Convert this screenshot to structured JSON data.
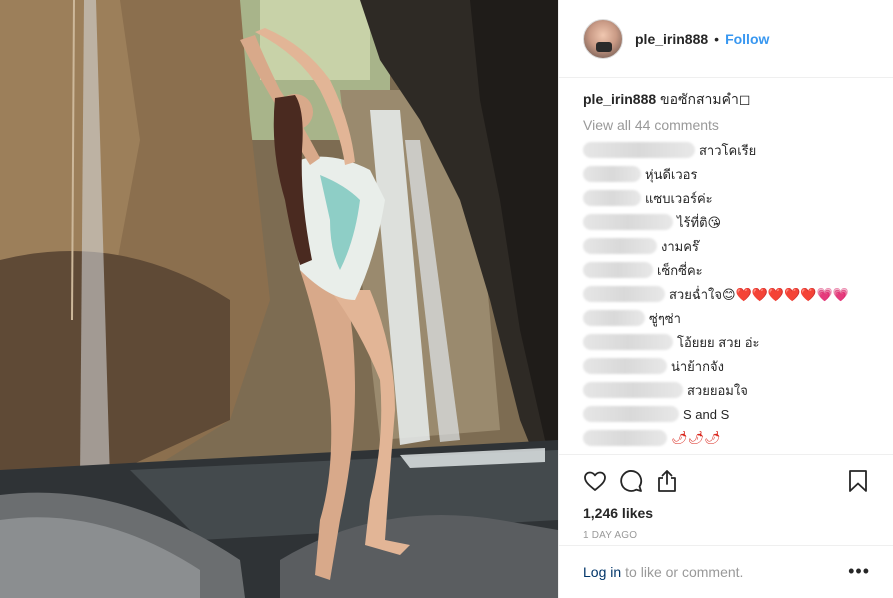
{
  "post": {
    "username": "ple_irin888",
    "follow_dot": "•",
    "follow_label": "Follow",
    "caption_username": "ple_irin888",
    "caption_text": "ขอซักสามคำ◻",
    "view_all": "View all 44 comments"
  },
  "comments": [
    {
      "text": "สาวโคเรีย"
    },
    {
      "text": "หุ่นดีเวอร"
    },
    {
      "text": "แซบเวอร์ค่ะ"
    },
    {
      "text": "ไร้ที่ติ😘"
    },
    {
      "text": "งามคร๊"
    },
    {
      "text": "เซ็กซี่คะ"
    },
    {
      "text": "สวยฉ่ำใจ😊❤️❤️❤️❤️❤️💗💗"
    },
    {
      "text": "ซู่ๆซ่า"
    },
    {
      "text": "โอ้ยยย สวย อ่ะ"
    },
    {
      "text": "น่าย้ากจัง"
    },
    {
      "text": "สวยยอมใจ"
    },
    {
      "text": "S and S"
    },
    {
      "text": "🌶🌶🌶"
    }
  ],
  "actions": {
    "like_icon": "heart-icon",
    "comment_icon": "comment-icon",
    "share_icon": "share-icon",
    "save_icon": "bookmark-icon",
    "likes": "1,246 likes",
    "time": "1 DAY AGO"
  },
  "footer": {
    "login_link": "Log in",
    "login_rest": "to like or comment.",
    "more": "•••"
  },
  "colors": {
    "accent": "#3897f0",
    "link_dark": "#003569",
    "muted": "#999999",
    "text": "#262626",
    "divider": "#efefef"
  }
}
